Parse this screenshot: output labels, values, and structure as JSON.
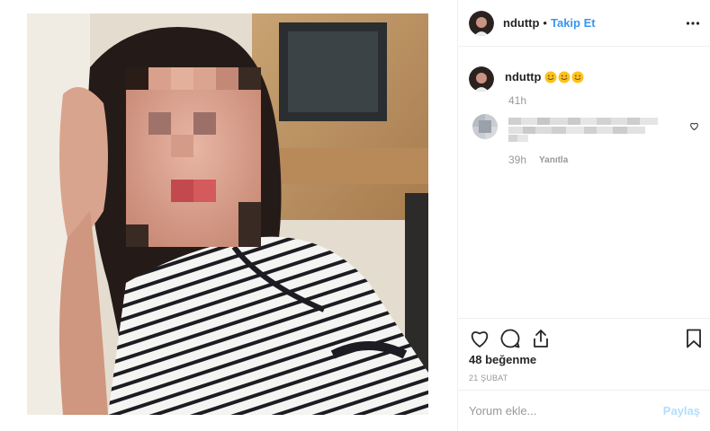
{
  "post": {
    "username": "nduttp",
    "follow_label": "Takip Et",
    "header_separator": "•",
    "more_icon": "more-horizontal-icon"
  },
  "caption": {
    "username": "nduttp",
    "emojis": [
      "smiling-face-emoji",
      "smiling-face-emoji",
      "smiling-face-emoji"
    ],
    "time": "41h"
  },
  "comment": {
    "time": "39h",
    "reply_label": "Yanıtla"
  },
  "actions": {
    "icons": [
      "heart-icon",
      "comment-bubble-icon",
      "share-icon",
      "bookmark-icon"
    ],
    "likes_text": "48 beğenme",
    "date": "21 ŞUBAT"
  },
  "comment_input": {
    "placeholder": "Yorum ekle...",
    "submit_label": "Paylaş"
  },
  "colors": {
    "accent_link": "#3897f0",
    "submit_disabled": "#b2dffc",
    "muted_text": "#999999",
    "divider": "#efefef"
  }
}
